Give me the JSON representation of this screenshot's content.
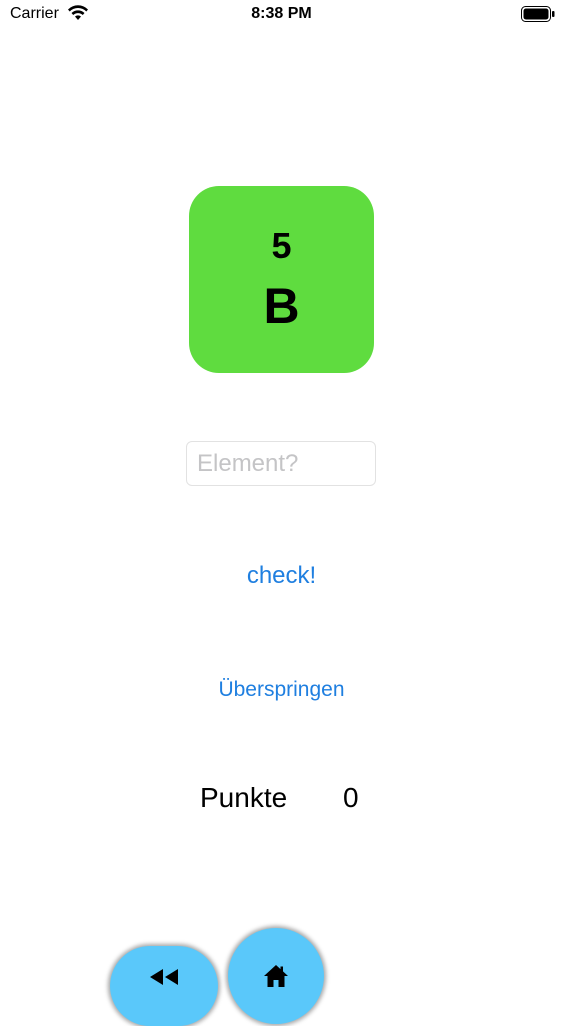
{
  "status_bar": {
    "carrier": "Carrier",
    "time": "8:38 PM",
    "icons": [
      "wifi-icon",
      "battery-icon"
    ]
  },
  "tile": {
    "atomic_number": "5",
    "symbol": "B",
    "color": "#5fdc3f"
  },
  "input": {
    "placeholder": "Element?",
    "value": ""
  },
  "actions": {
    "check_label": "check!",
    "skip_label": "Überspringen",
    "link_color": "#1f7fe0"
  },
  "score": {
    "label": "Punkte",
    "value": "0"
  },
  "bottom_bar": {
    "button_color": "#5ac8fa",
    "icons": [
      "rewind-icon",
      "home-icon"
    ]
  }
}
